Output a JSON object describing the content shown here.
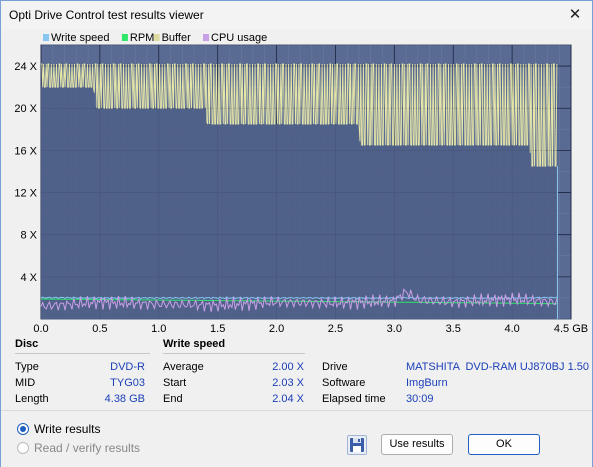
{
  "window": {
    "title": "Opti Drive Control test results viewer",
    "close_glyph": "✕"
  },
  "legend": [
    {
      "label": "Write speed",
      "color": "#87c6f0"
    },
    {
      "label": "RPM",
      "color": "#2ee66a"
    },
    {
      "label": "Buffer",
      "color": "#dcdca0"
    },
    {
      "label": "CPU usage",
      "color": "#c8a0e6"
    }
  ],
  "chart_data": {
    "type": "line",
    "x_unit": "GB",
    "xlim": [
      0,
      4.5
    ],
    "ylim": [
      0,
      26
    ],
    "x_ticks": [
      "0.0",
      "0.5",
      "1.0",
      "1.5",
      "2.0",
      "2.5",
      "3.0",
      "3.5",
      "4.0",
      "4.5 GB"
    ],
    "y_ticks": [
      "4 X",
      "8 X",
      "12 X",
      "16 X",
      "20 X",
      "24 X"
    ],
    "grid": true,
    "legend_position": "top-left",
    "series": [
      {
        "name": "Write speed",
        "x": [
          0,
          0.02,
          0.5,
          1.0,
          1.5,
          2.0,
          2.5,
          3.0,
          3.5,
          4.0,
          4.35,
          4.38
        ],
        "y": [
          2.0,
          2.03,
          2.0,
          2.0,
          2.0,
          2.0,
          2.0,
          2.0,
          2.0,
          2.0,
          2.04,
          2.04
        ]
      },
      {
        "name": "RPM",
        "x": [
          0,
          0.5,
          1.0,
          1.5,
          2.0,
          2.5,
          3.0,
          3.5,
          4.0,
          4.38
        ],
        "y": [
          1.9,
          1.85,
          1.8,
          1.75,
          1.7,
          1.65,
          1.6,
          1.55,
          1.5,
          1.45
        ]
      },
      {
        "name": "Buffer",
        "x": [
          0,
          0.05,
          0.45,
          0.46,
          1.4,
          1.41,
          2.7,
          2.71,
          4.15,
          4.16,
          4.38,
          4.39
        ],
        "y": [
          22,
          22,
          22,
          20,
          20,
          18.5,
          18.5,
          16.5,
          16.5,
          14.5,
          14.5,
          0
        ]
      },
      {
        "name": "CPU usage",
        "x": [
          0,
          0.5,
          1.0,
          1.5,
          2.0,
          2.5,
          3.0,
          3.1,
          3.2,
          3.5,
          4.0,
          4.38
        ],
        "y": [
          1.2,
          1.6,
          1.4,
          1.3,
          1.6,
          1.5,
          1.7,
          2.6,
          1.8,
          1.6,
          1.9,
          1.6
        ]
      }
    ]
  },
  "disc": {
    "header": "Disc",
    "rows": [
      {
        "label": "Type",
        "value": "DVD-R"
      },
      {
        "label": "MID",
        "value": "TYG03"
      },
      {
        "label": "Length",
        "value": "4.38 GB"
      }
    ]
  },
  "write_speed": {
    "header": "Write speed",
    "rows": [
      {
        "label": "Average",
        "value": "2.00 X"
      },
      {
        "label": "Start",
        "value": "2.03 X"
      },
      {
        "label": "End",
        "value": "2.04 X"
      }
    ]
  },
  "info": {
    "rows": [
      {
        "label": "Drive",
        "value": "MATSHITA  DVD-RAM UJ870BJ 1.50"
      },
      {
        "label": "Software",
        "value": "ImgBurn"
      },
      {
        "label": "Elapsed time",
        "value": "30:09"
      }
    ]
  },
  "options": {
    "write_results": "Write results",
    "read_verify": "Read / verify results"
  },
  "buttons": {
    "use_results": "Use results",
    "ok": "OK",
    "save_icon": "floppy-disk"
  }
}
